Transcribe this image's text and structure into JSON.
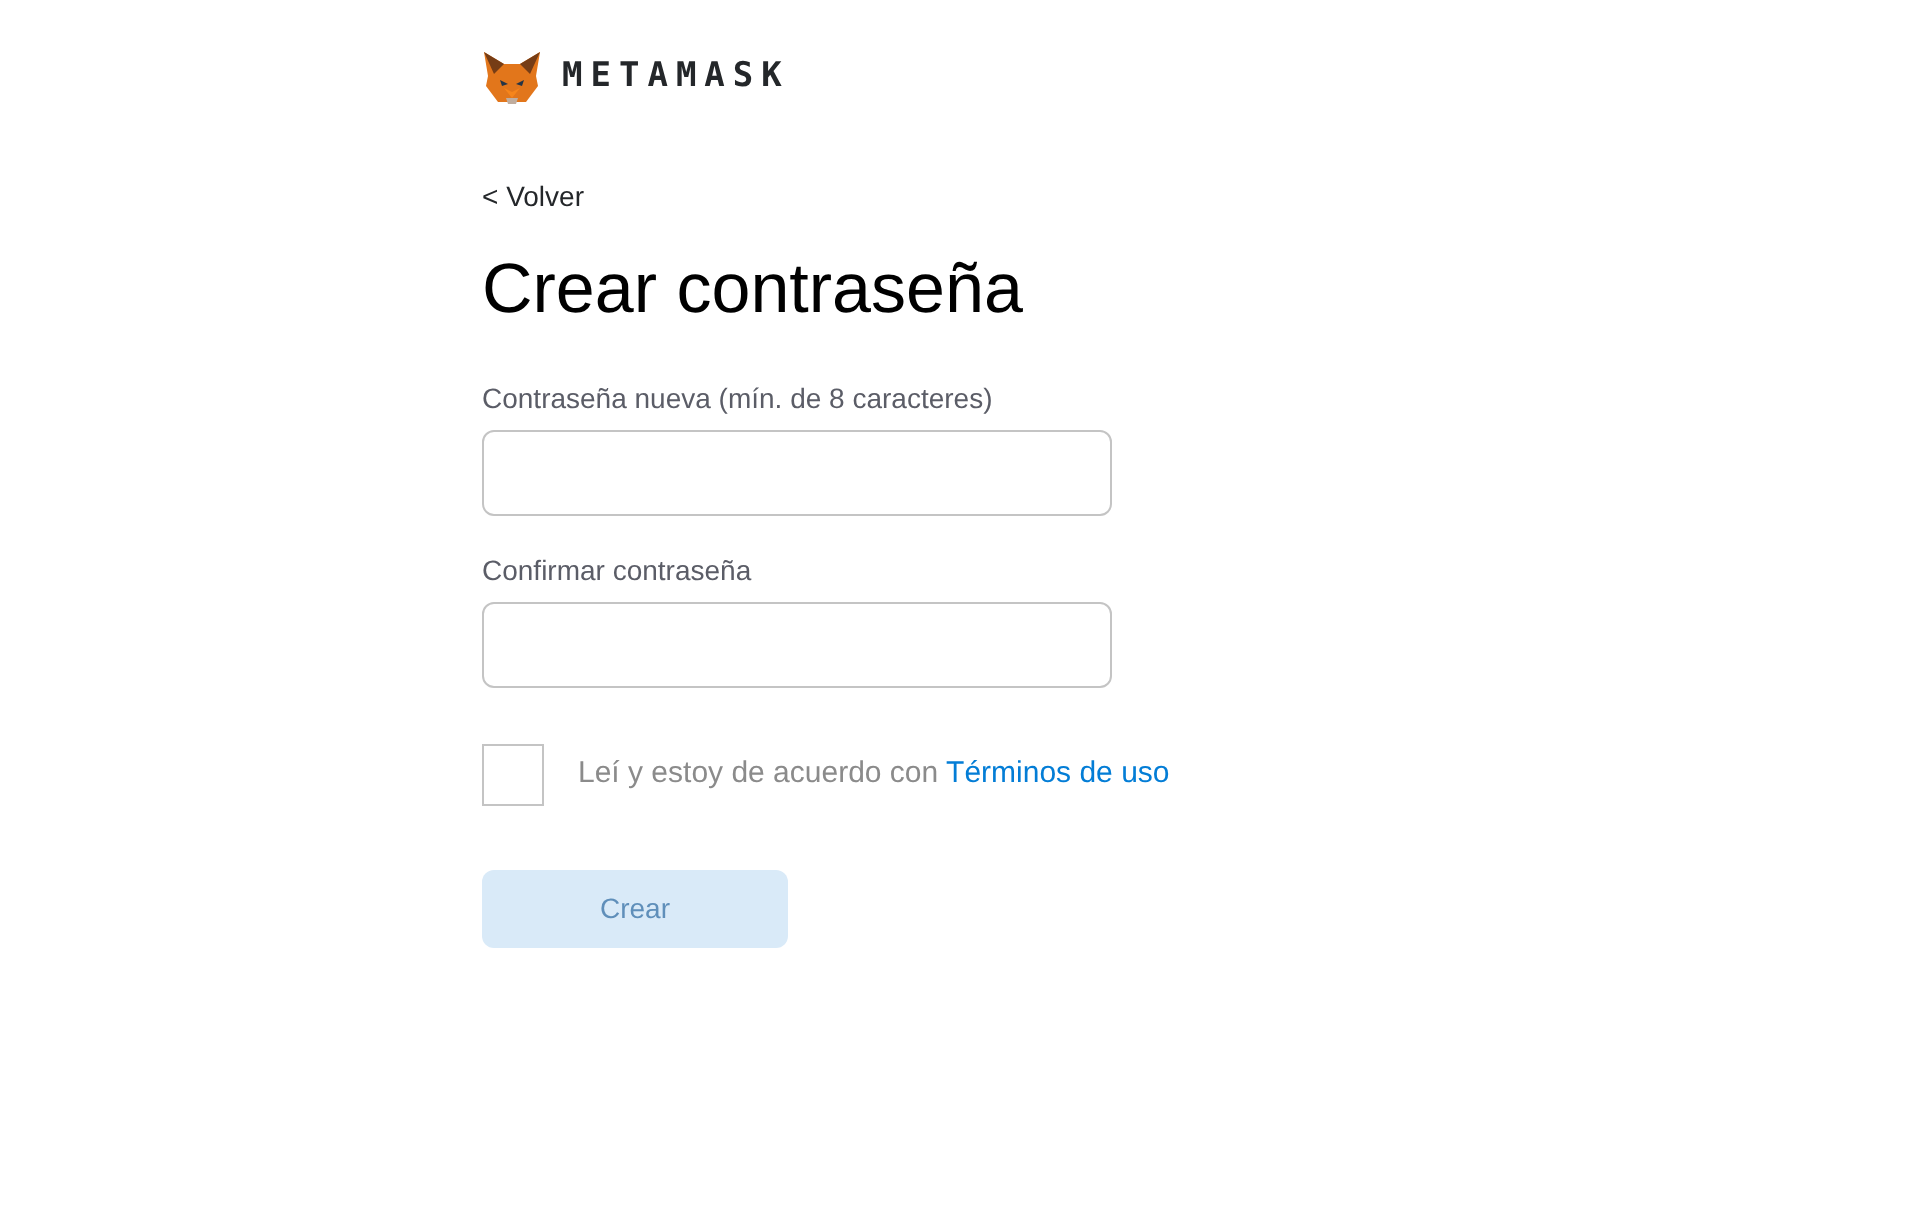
{
  "logo": {
    "wordmark": "METAMASK"
  },
  "back_link": "< Volver",
  "title": "Crear contraseña",
  "fields": [
    {
      "label": "Contraseña nueva (mín. de 8 caracteres)"
    },
    {
      "label": "Confirmar contraseña"
    }
  ],
  "agreement": {
    "checked": false,
    "text": "Leí y estoy de acuerdo con",
    "link": "Términos de uso"
  },
  "submit": {
    "label": "Crear",
    "disabled": true
  }
}
